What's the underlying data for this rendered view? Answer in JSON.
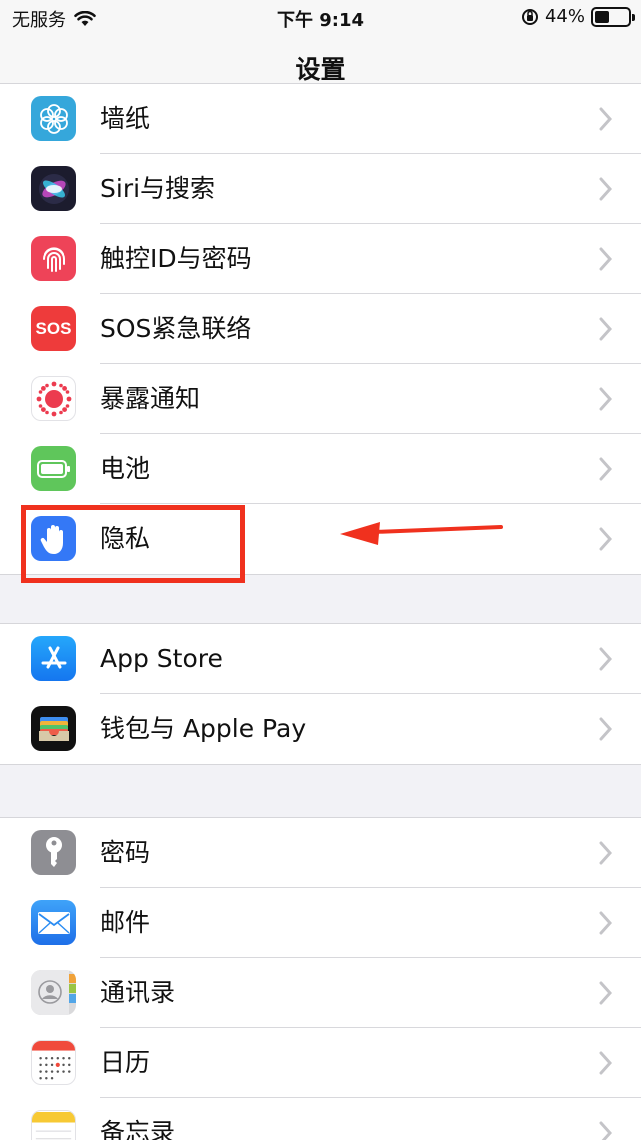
{
  "status_bar": {
    "carrier": "无服务",
    "time": "下午 9:14",
    "battery_pct": "44%",
    "battery_level": 0.44
  },
  "nav": {
    "title": "设置"
  },
  "groups": [
    {
      "items": [
        {
          "label": "墙纸",
          "icon": "wallpaper-icon"
        },
        {
          "label": "Siri与搜索",
          "icon": "siri-icon"
        },
        {
          "label": "触控ID与密码",
          "icon": "fingerprint-icon"
        },
        {
          "label": "SOS紧急联络",
          "icon": "sos-icon",
          "icon_text": "SOS"
        },
        {
          "label": "暴露通知",
          "icon": "exposure-icon"
        },
        {
          "label": "电池",
          "icon": "battery-icon"
        },
        {
          "label": "隐私",
          "icon": "hand-icon"
        }
      ]
    },
    {
      "items": [
        {
          "label": "App Store",
          "icon": "app-store-icon"
        },
        {
          "label": "钱包与 Apple Pay",
          "icon": "wallet-icon"
        }
      ]
    },
    {
      "items": [
        {
          "label": "密码",
          "icon": "key-icon"
        },
        {
          "label": "邮件",
          "icon": "mail-icon"
        },
        {
          "label": "通讯录",
          "icon": "contacts-icon"
        },
        {
          "label": "日历",
          "icon": "calendar-icon"
        },
        {
          "label": "备忘录",
          "icon": "notes-icon"
        }
      ]
    }
  ],
  "colors": {
    "highlight": "#f0311e",
    "chevron": "#c4c4c8",
    "sos": "#ee3b3b",
    "battery": "#5fc65b",
    "privacy": "#3478f6",
    "app_store": "#1d8cf7",
    "mail": "#2a8cf2"
  }
}
